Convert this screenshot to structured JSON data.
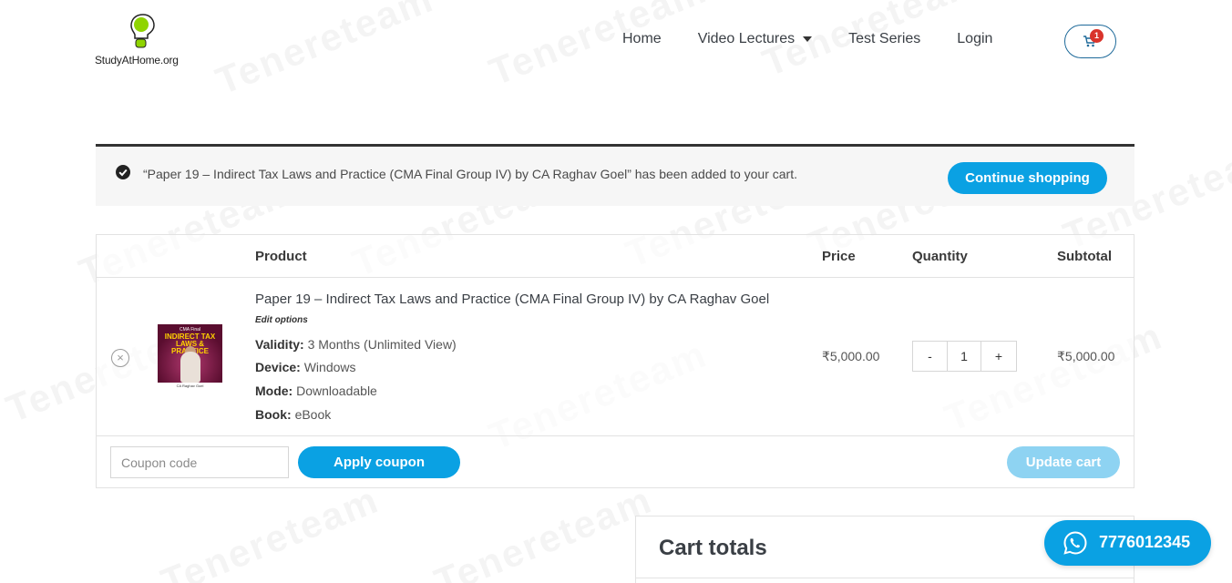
{
  "brand": {
    "logo_text": "StudyAtHome.org"
  },
  "watermark": {
    "text": "Tenereteam"
  },
  "nav": {
    "items": [
      {
        "label": "Home"
      },
      {
        "label": "Video Lectures"
      },
      {
        "label": "Test Series"
      },
      {
        "label": "Login"
      }
    ],
    "cart_count": "1"
  },
  "notice": {
    "message": "“Paper 19 – Indirect Tax Laws and Practice (CMA Final Group IV) by CA Raghav Goel” has been added to your cart.",
    "continue_label": "Continue shopping"
  },
  "table": {
    "headers": {
      "product": "Product",
      "price": "Price",
      "quantity": "Quantity",
      "subtotal": "Subtotal"
    },
    "item": {
      "remove_icon": "×",
      "thumb_top": "CMA Final",
      "thumb_title": "INDIRECT TAX LAWS & PRACTICE",
      "thumb_author": "CA Raghav Goel",
      "name": "Paper 19 – Indirect Tax Laws and Practice (CMA Final Group IV) by CA Raghav Goel",
      "edit_options": "Edit options",
      "meta": [
        {
          "key": "Validity:",
          "value": "3 Months (Unlimited View)"
        },
        {
          "key": "Device:",
          "value": "Windows"
        },
        {
          "key": "Mode:",
          "value": "Downloadable"
        },
        {
          "key": "Book:",
          "value": "eBook"
        }
      ],
      "price": "₹5,000.00",
      "qty_minus": "-",
      "quantity": "1",
      "qty_plus": "+",
      "subtotal": "₹5,000.00"
    },
    "coupon_placeholder": "Coupon code",
    "apply_label": "Apply coupon",
    "update_label": "Update cart"
  },
  "totals": {
    "title": "Cart totals"
  },
  "whatsapp": {
    "number": "7776012345"
  },
  "colors": {
    "accent": "#0aa1e3",
    "accent_disabled": "#8ed3f2",
    "badge": "#d9342b",
    "logo_green": "#8fd400"
  }
}
